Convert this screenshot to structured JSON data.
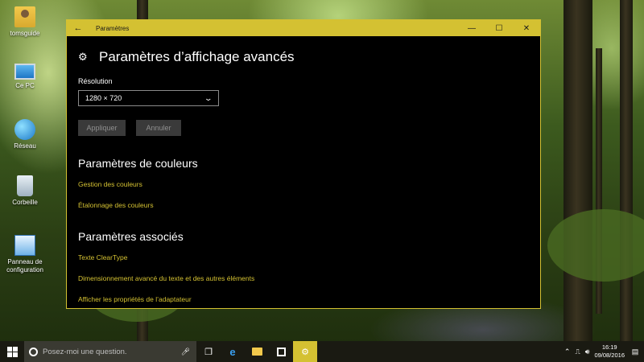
{
  "desktop": {
    "icons": [
      {
        "label": "tomsguide",
        "icon": "user-folder-icon"
      },
      {
        "label": "Ce PC",
        "icon": "computer-icon"
      },
      {
        "label": "Réseau",
        "icon": "network-icon"
      },
      {
        "label": "Corbeille",
        "icon": "recycle-bin-icon"
      },
      {
        "label": "Panneau de configuration",
        "icon": "control-panel-icon"
      }
    ]
  },
  "window": {
    "title": "Paramètres",
    "accent": "#d4c132",
    "controls": {
      "minimize": "—",
      "maximize": "☐",
      "close": "✕"
    },
    "back_icon": "←",
    "page_title": "Paramètres d’affichage avancés",
    "gear_icon": "⚙",
    "resolution_label": "Résolution",
    "resolution_value": "1280 × 720",
    "apply_label": "Appliquer",
    "cancel_label": "Annuler",
    "color_section_title": "Paramètres de couleurs",
    "color_links": [
      "Gestion des couleurs",
      "Étalonnage des couleurs"
    ],
    "related_section_title": "Paramètres associés",
    "related_links": [
      "Texte ClearType",
      "Dimensionnement avancé du texte et des autres éléments",
      "Afficher les propriétés de l’adaptateur"
    ]
  },
  "taskbar": {
    "search_placeholder": "Posez-moi une question.",
    "time": "16:19",
    "date": "09/08/2016"
  }
}
